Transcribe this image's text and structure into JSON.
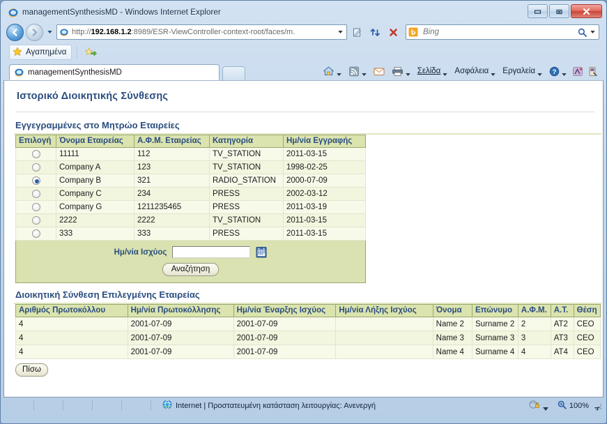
{
  "window": {
    "title": "managementSynthesisMD - Windows Internet Explorer",
    "title_icon": "ie-logo-icon",
    "minimize_label": "Minimize",
    "restore_label": "Restore",
    "close_label": "Close"
  },
  "navbar": {
    "back_label": "Back",
    "forward_label": "Forward",
    "history_label": "Recent Pages",
    "address_icon": "ie-logo-icon",
    "address_prefix": "http://",
    "address_host": "192.168.1.2",
    "address_suffix": ":8989/ESR-ViewController-context-root/faces/m.",
    "address_full": "http://192.168.1.2:8989/ESR-ViewController-context-root/faces/m.",
    "compat_label": "Compatibility View",
    "refresh_label": "Refresh",
    "stop_label": "Stop",
    "search_engine": "bing-icon",
    "search_placeholder": "Bing",
    "search_value": "",
    "search_go_label": "Search"
  },
  "favorites_bar": {
    "favorites_label": "Αγαπημένα",
    "favorites_icon": "star-icon",
    "add_icon": "add-to-favorites-icon"
  },
  "tabs": {
    "items": [
      {
        "label": "managementSynthesisMD",
        "icon": "ie-logo-icon",
        "active": true
      }
    ],
    "new_tab_label": "New Tab"
  },
  "command_bar": {
    "items": [
      {
        "name": "home",
        "label": "",
        "icon": "home-icon",
        "has_caret": true
      },
      {
        "name": "feeds",
        "label": "",
        "icon": "rss-icon",
        "has_caret": true
      },
      {
        "name": "read-mail",
        "label": "",
        "icon": "mail-icon",
        "has_caret": false
      },
      {
        "name": "print",
        "label": "",
        "icon": "printer-icon",
        "has_caret": true
      },
      {
        "name": "page",
        "label": "Σελίδα",
        "icon": "",
        "has_caret": true
      },
      {
        "name": "safety",
        "label": "Ασφάλεια",
        "icon": "",
        "has_caret": true
      },
      {
        "name": "tools",
        "label": "Εργαλεία",
        "icon": "",
        "has_caret": true
      },
      {
        "name": "help",
        "label": "",
        "icon": "help-icon",
        "has_caret": true
      },
      {
        "name": "addon1",
        "label": "",
        "icon": "addon-icon",
        "has_caret": false
      },
      {
        "name": "addon2",
        "label": "",
        "icon": "research-icon",
        "has_caret": false
      }
    ]
  },
  "page": {
    "title": "Ιστορικό Διοικητικής Σύνθεσης",
    "section1": {
      "heading": "Εγγεγραμμένες στο Μητρώο Εταιρείες",
      "columns": [
        "Επιλογή",
        "Όνομα Εταιρείας",
        "Α.Φ.Μ. Εταιρείας",
        "Κατηγορία",
        "Ημ/νία Εγγραφής"
      ],
      "rows": [
        {
          "selected": false,
          "name": "11111",
          "afm": "112",
          "category": "TV_STATION",
          "reg_date": "2011-03-15"
        },
        {
          "selected": false,
          "name": "Company A",
          "afm": "123",
          "category": "TV_STATION",
          "reg_date": "1998-02-25"
        },
        {
          "selected": true,
          "name": "Company B",
          "afm": "321",
          "category": "RADIO_STATION",
          "reg_date": "2000-07-09"
        },
        {
          "selected": false,
          "name": "Company C",
          "afm": "234",
          "category": "PRESS",
          "reg_date": "2002-03-12"
        },
        {
          "selected": false,
          "name": "Company G",
          "afm": "1211235465",
          "category": "PRESS",
          "reg_date": "2011-03-19"
        },
        {
          "selected": false,
          "name": "2222",
          "afm": "2222",
          "category": "TV_STATION",
          "reg_date": "2011-03-15"
        },
        {
          "selected": false,
          "name": "333",
          "afm": "333",
          "category": "PRESS",
          "reg_date": "2011-03-15"
        }
      ],
      "filter": {
        "label": "Ημ/νία Ισχύος",
        "value": "",
        "placeholder": "",
        "calendar_icon": "calendar-icon",
        "search_button": "Αναζήτηση"
      }
    },
    "section2": {
      "heading": "Διοικητική Σύνθεση Επιλεγμένης Εταιρείας",
      "columns": [
        "Αριθμός Πρωτοκόλλου",
        "Ημ/νία Πρωτοκόλλησης",
        "Ημ/νία Έναρξης Ισχύος",
        "Ημ/νία Λήξης Ισχύος",
        "Όνομα",
        "Επώνυμο",
        "Α.Φ.Μ.",
        "Α.Τ.",
        "Θέση"
      ],
      "rows": [
        {
          "protocol_no": "4",
          "protocol_date": "2001-07-09",
          "start_date": "2001-07-09",
          "end_date": "",
          "first_name": "Name 2",
          "last_name": "Surname 2",
          "afm": "2",
          "at": "AT2",
          "position": "CEO"
        },
        {
          "protocol_no": "4",
          "protocol_date": "2001-07-09",
          "start_date": "2001-07-09",
          "end_date": "",
          "first_name": "Name 3",
          "last_name": "Surname 3",
          "afm": "3",
          "at": "AT3",
          "position": "CEO"
        },
        {
          "protocol_no": "4",
          "protocol_date": "2001-07-09",
          "start_date": "2001-07-09",
          "end_date": "",
          "first_name": "Name 4",
          "last_name": "Surname 4",
          "afm": "4",
          "at": "AT4",
          "position": "CEO"
        }
      ],
      "back_button": "Πίσω"
    }
  },
  "status_bar": {
    "zone_icon": "globe-icon",
    "zone_text": "Internet | Προστατευμένη κατάσταση λειτουργίας: Ανενεργή",
    "zoom_level": "100%",
    "zoom_icon": "magnifier-icon",
    "privacy_icon": "privacy-report-icon"
  },
  "colors": {
    "title_blue": "#2a4d7f",
    "header_olive": "#dbe3ae",
    "row_cream": "#f7f9e9",
    "row_alt": "#f2f6df",
    "filter_band": "#d9e2b0",
    "accent_close": "#c8453a"
  }
}
